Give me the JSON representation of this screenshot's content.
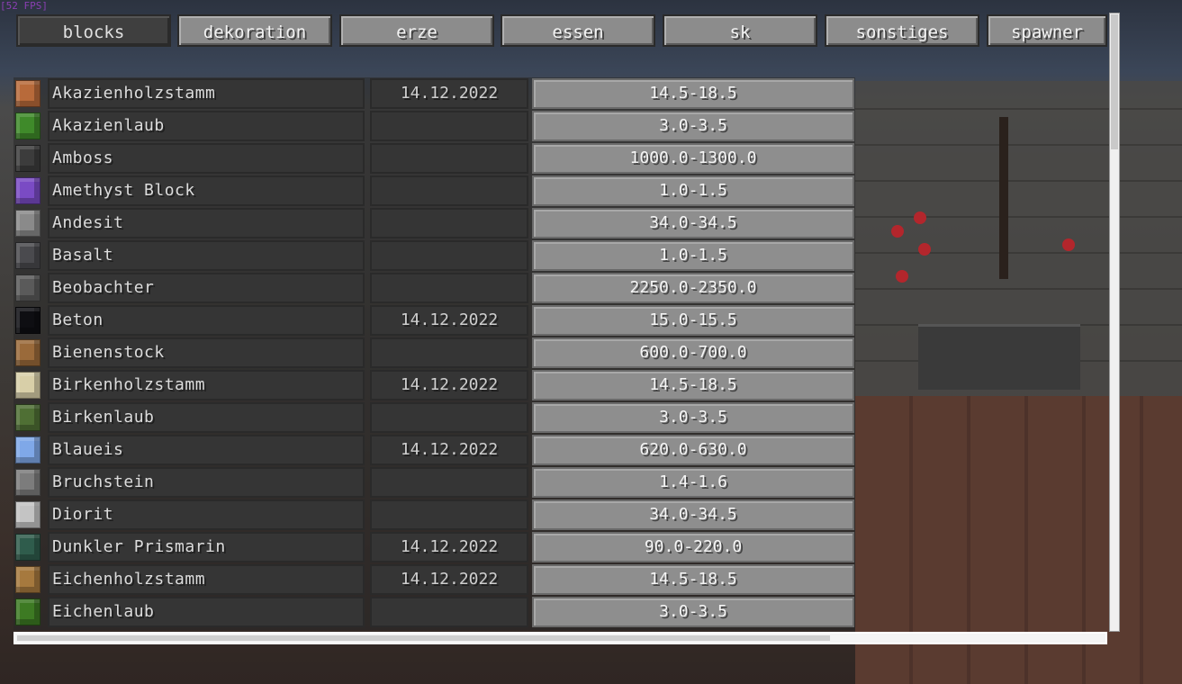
{
  "hud": {
    "fps_text": "[52 FPS]"
  },
  "tabs": [
    {
      "label": "blocks",
      "active": true
    },
    {
      "label": "dekoration",
      "active": false
    },
    {
      "label": "erze",
      "active": false
    },
    {
      "label": "essen",
      "active": false
    },
    {
      "label": "sk",
      "active": false
    },
    {
      "label": "sonstiges",
      "active": false
    },
    {
      "label": "spawner",
      "active": false
    }
  ],
  "rows": [
    {
      "name": "Akazienholzstamm",
      "date": "14.12.2022",
      "price": "14.5-18.5",
      "icon": "acacia-log-icon",
      "color": "#b86a3a"
    },
    {
      "name": "Akazienlaub",
      "date": "",
      "price": "3.0-3.5",
      "icon": "acacia-leaves-icon",
      "color": "#3f8a2a"
    },
    {
      "name": "Amboss",
      "date": "",
      "price": "1000.0-1300.0",
      "icon": "anvil-icon",
      "color": "#3c3c3c"
    },
    {
      "name": "Amethyst Block",
      "date": "",
      "price": "1.0-1.5",
      "icon": "amethyst-block-icon",
      "color": "#7a4bc4"
    },
    {
      "name": "Andesit",
      "date": "",
      "price": "34.0-34.5",
      "icon": "andesite-icon",
      "color": "#8a8a8a"
    },
    {
      "name": "Basalt",
      "date": "",
      "price": "1.0-1.5",
      "icon": "basalt-icon",
      "color": "#4a4a4e"
    },
    {
      "name": "Beobachter",
      "date": "",
      "price": "2250.0-2350.0",
      "icon": "observer-icon",
      "color": "#5a5a5a"
    },
    {
      "name": "Beton",
      "date": "14.12.2022",
      "price": "15.0-15.5",
      "icon": "concrete-icon",
      "color": "#0e0e12"
    },
    {
      "name": "Bienenstock",
      "date": "",
      "price": "600.0-700.0",
      "icon": "beehive-icon",
      "color": "#9a6a3a"
    },
    {
      "name": "Birkenholzstamm",
      "date": "14.12.2022",
      "price": "14.5-18.5",
      "icon": "birch-log-icon",
      "color": "#d8cfa8"
    },
    {
      "name": "Birkenlaub",
      "date": "",
      "price": "3.0-3.5",
      "icon": "birch-leaves-icon",
      "color": "#4f6f34"
    },
    {
      "name": "Blaueis",
      "date": "14.12.2022",
      "price": "620.0-630.0",
      "icon": "blue-ice-icon",
      "color": "#7fa8e8"
    },
    {
      "name": "Bruchstein",
      "date": "",
      "price": "1.4-1.6",
      "icon": "cobblestone-icon",
      "color": "#7c7c7c"
    },
    {
      "name": "Diorit",
      "date": "",
      "price": "34.0-34.5",
      "icon": "diorite-icon",
      "color": "#c4c4c4"
    },
    {
      "name": "Dunkler Prismarin",
      "date": "14.12.2022",
      "price": "90.0-220.0",
      "icon": "dark-prismarine-icon",
      "color": "#2f5c4c"
    },
    {
      "name": "Eichenholzstamm",
      "date": "14.12.2022",
      "price": "14.5-18.5",
      "icon": "oak-log-icon",
      "color": "#a6793e"
    },
    {
      "name": "Eichenlaub",
      "date": "",
      "price": "3.0-3.5",
      "icon": "oak-leaves-icon",
      "color": "#3d7a23"
    }
  ]
}
